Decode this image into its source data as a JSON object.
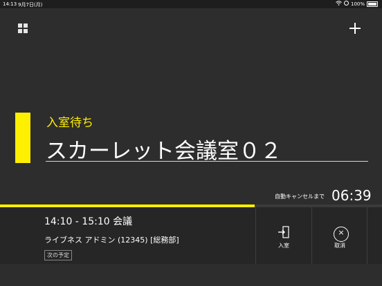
{
  "statusbar": {
    "time": "14:13",
    "date": "9月7日(月)",
    "battery": "100%"
  },
  "room": {
    "status": "入室待ち",
    "name": "スカーレット会議室０２"
  },
  "auto_cancel": {
    "label": "自動キャンセルまで",
    "countdown": "06:39",
    "progress_fraction": 0.667
  },
  "meeting": {
    "time_title": "14:10 - 15:10 会議",
    "organizer": "ライブネス アドミン (12345) [総務部]",
    "next_badge": "次の予定"
  },
  "actions": {
    "enter_label": "入室",
    "cancel_label": "取消"
  },
  "colors": {
    "accent": "#ffef00",
    "background": "#2d2d2d"
  },
  "icons": {
    "menu": "grid-icon",
    "add": "plus-icon",
    "enter": "enter-door-icon",
    "cancel": "close-circle-icon"
  }
}
